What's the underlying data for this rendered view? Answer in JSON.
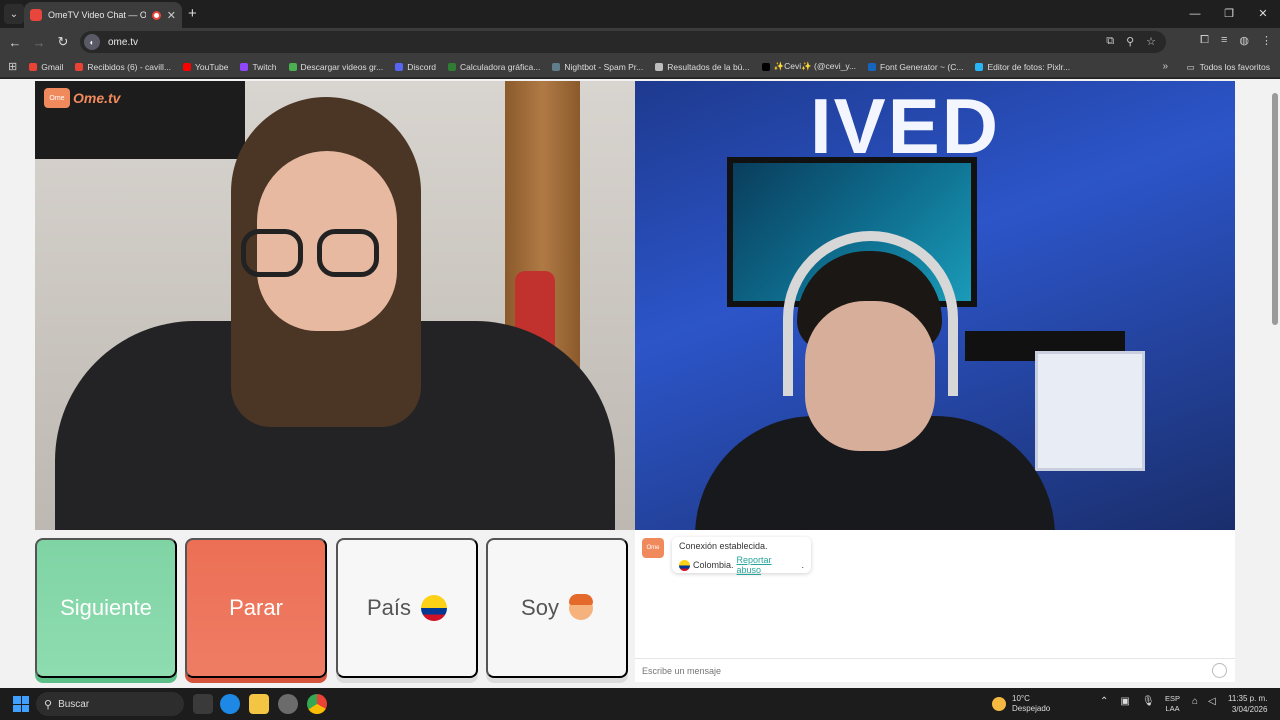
{
  "browser": {
    "tab_title": "OmeTV Video Chat — Ome",
    "url": "ome.tv",
    "window_controls": [
      "—",
      "❐",
      "✕"
    ]
  },
  "bookmarks": [
    {
      "label": "Gmail",
      "color": "#ea4335"
    },
    {
      "label": "Recibidos (6) - cavill...",
      "color": "#ea4335"
    },
    {
      "label": "YouTube",
      "color": "#ff0000"
    },
    {
      "label": "Twitch",
      "color": "#9146ff"
    },
    {
      "label": "Descargar videos gr...",
      "color": "#4caf50"
    },
    {
      "label": "Discord",
      "color": "#5865f2"
    },
    {
      "label": "Calculadora gráfica...",
      "color": "#2e7d32"
    },
    {
      "label": "Nightbot - Spam Pr...",
      "color": "#607d8b"
    },
    {
      "label": "Resultados de la bú...",
      "color": "#bdbdbd"
    },
    {
      "label": "✨Cevi✨ (@cevi_y...",
      "color": "#000000"
    },
    {
      "label": "Font Generator ~ (C...",
      "color": "#1565c0"
    },
    {
      "label": "Editor de fotos: Pixlr...",
      "color": "#29b6f6"
    }
  ],
  "bookmarks_all": "Todos los favoritos",
  "logo": {
    "box": "Ome",
    "text": "Ome.tv"
  },
  "remote_wall_text": "IVED",
  "buttons": {
    "next": "Siguiente",
    "stop": "Parar",
    "country": "País",
    "gender": "Soy"
  },
  "chat": {
    "logo": "Ome",
    "system_message": "Conexión establecida.",
    "country": "Colombia.",
    "report_link": "Reportar abuso",
    "report_suffix": ".",
    "input_placeholder": "Escribe un mensaje"
  },
  "taskbar": {
    "search": "Buscar",
    "temperature": "10°C",
    "weather": "Despejado",
    "lang_1": "ESP",
    "lang_2": "LAA",
    "time": "11:35 p. m.",
    "date": "3/04/2026"
  },
  "colors": {
    "next_green": "#8edcb0",
    "stop_red": "#ee7d64",
    "brand_orange": "#f08a5d",
    "link_teal": "#26a69a"
  }
}
